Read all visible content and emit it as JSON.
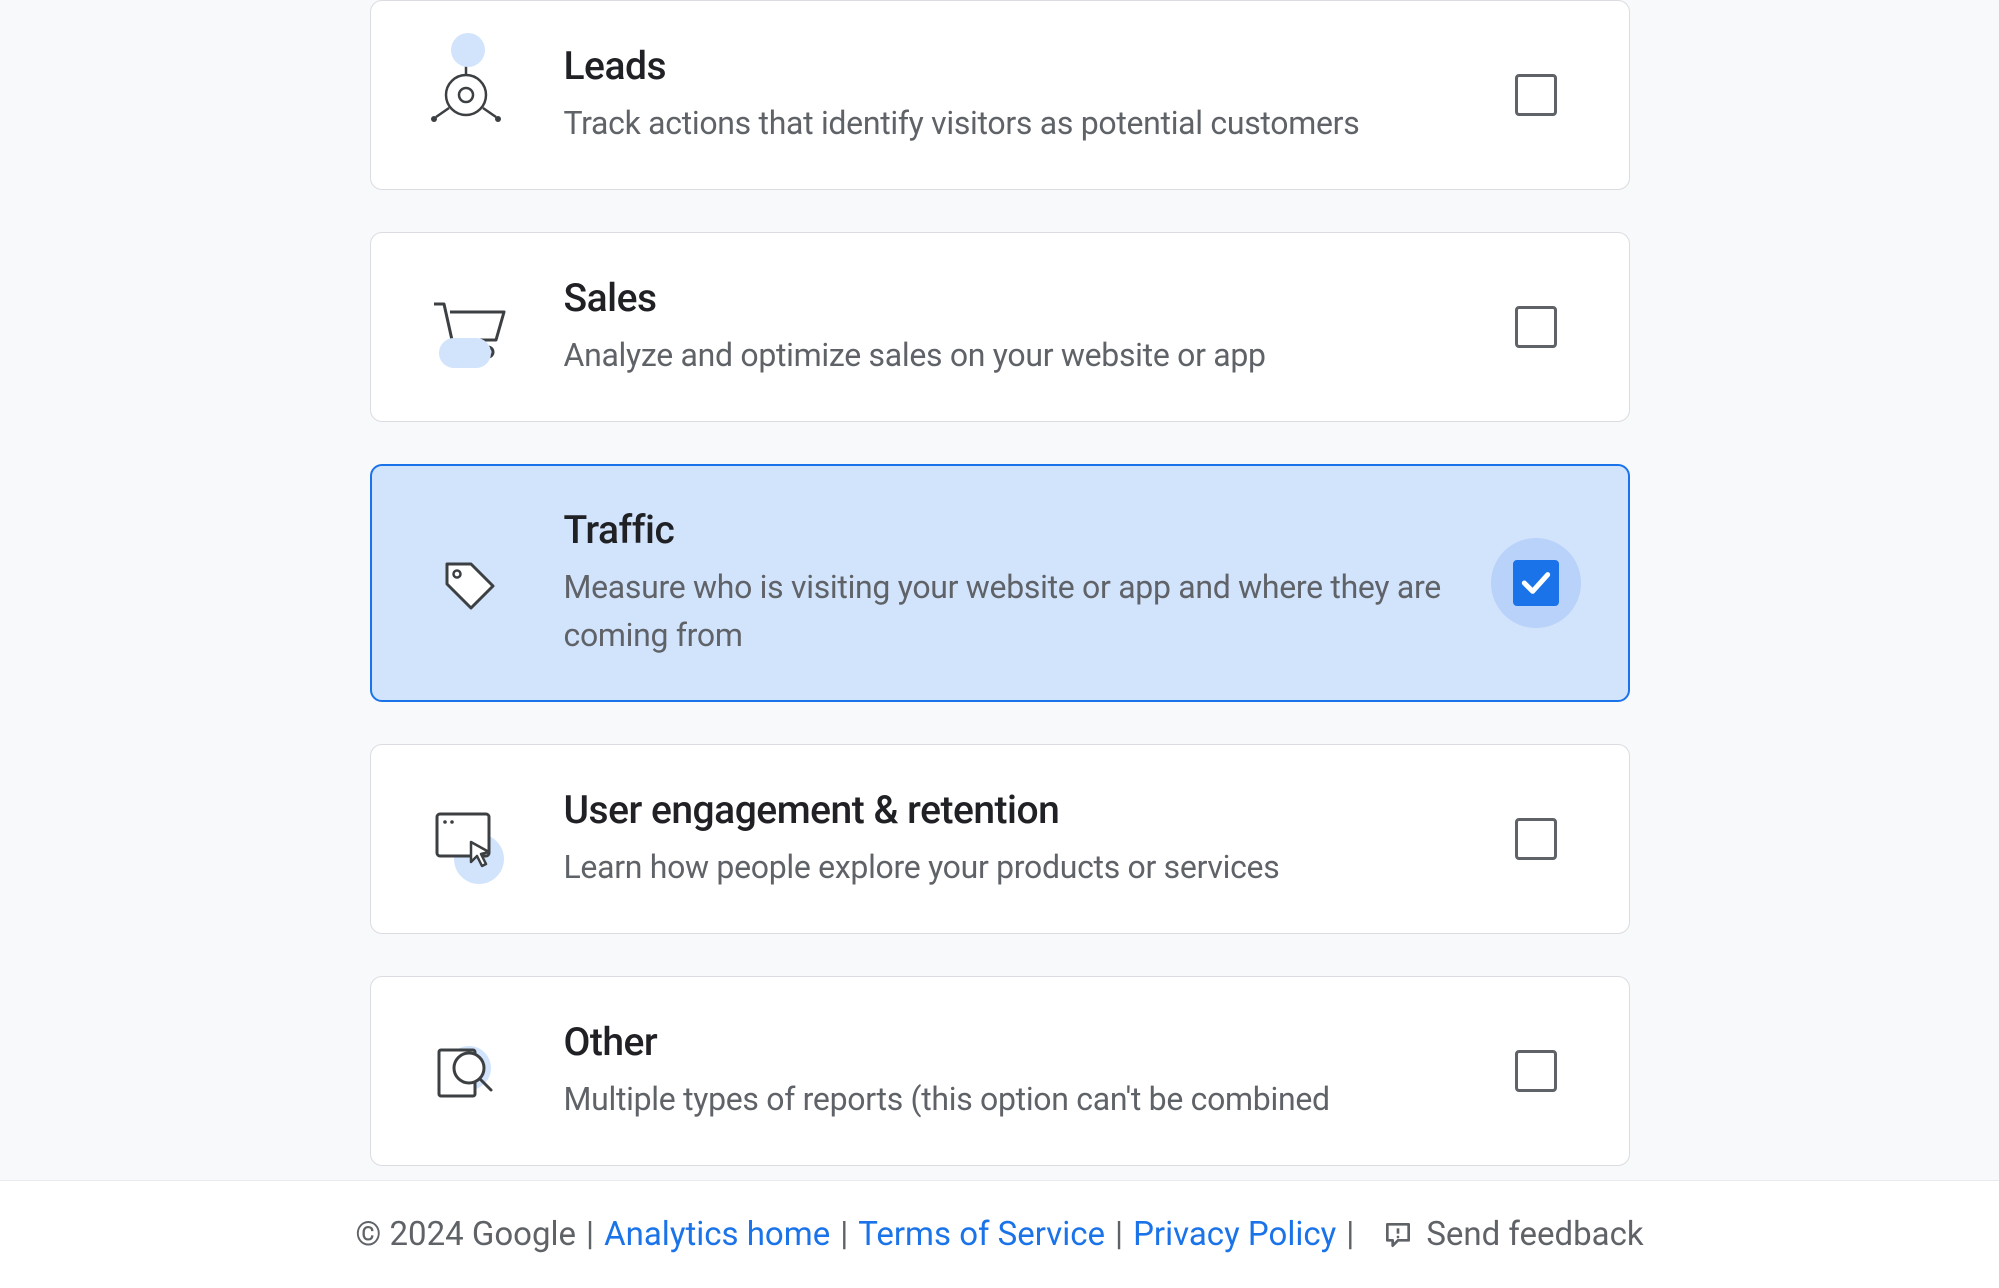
{
  "cards": [
    {
      "id": "leads",
      "title": "Leads",
      "description": "Track actions that identify visitors as potential customers",
      "checked": false
    },
    {
      "id": "sales",
      "title": "Sales",
      "description": "Analyze and optimize sales on your website or app",
      "checked": false
    },
    {
      "id": "traffic",
      "title": "Traffic",
      "description": "Measure who is visiting your website or app and where they are coming from",
      "checked": true
    },
    {
      "id": "engagement",
      "title": "User engagement & retention",
      "description": "Learn how people explore your products or services",
      "checked": false
    },
    {
      "id": "other",
      "title": "Other",
      "description": "Multiple types of reports (this option can't be combined",
      "checked": false
    }
  ],
  "footer": {
    "copyright": "© 2024 Google",
    "analytics_home": "Analytics home",
    "terms": "Terms of Service",
    "privacy": "Privacy Policy",
    "feedback": "Send feedback"
  }
}
